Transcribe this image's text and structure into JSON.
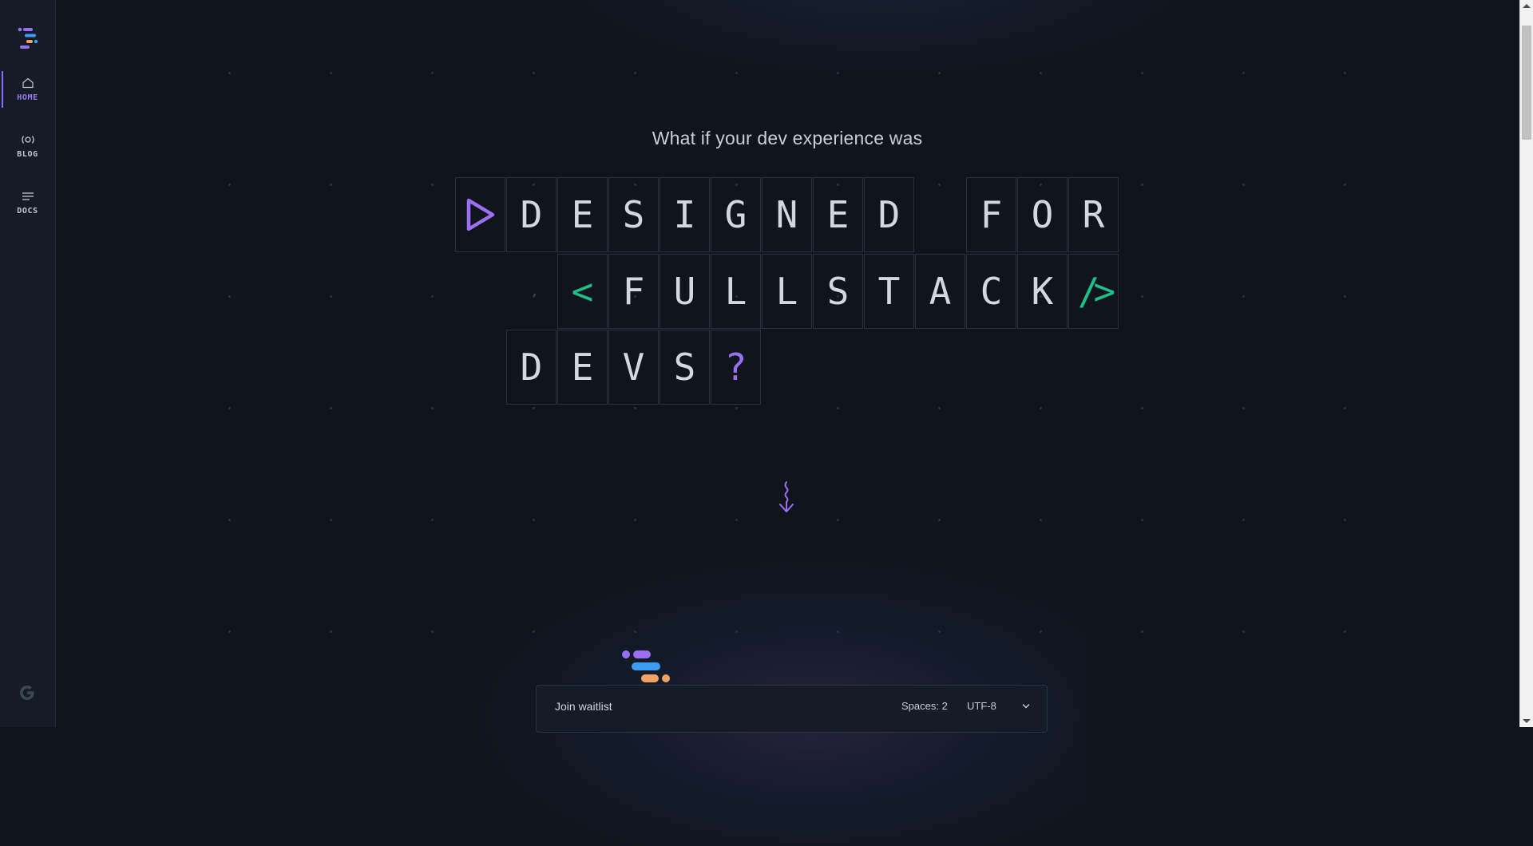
{
  "sidebar": {
    "items": [
      {
        "label": "HOME",
        "icon": "home-icon",
        "active": true
      },
      {
        "label": "BLOG",
        "icon": "broadcast-icon",
        "active": false
      },
      {
        "label": "DOCS",
        "icon": "lines-icon",
        "active": false
      }
    ],
    "footer_icon": "google-icon"
  },
  "hero": {
    "tagline": "What if your dev experience was",
    "row1": [
      "D",
      "E",
      "S",
      "I",
      "G",
      "N",
      "E",
      "D",
      "F",
      "O",
      "R"
    ],
    "row2": [
      "<",
      "F",
      "U",
      "L",
      "L",
      "S",
      "T",
      "A",
      "C",
      "K",
      "/>"
    ],
    "row3": [
      "D",
      "E",
      "V",
      "S",
      "?"
    ]
  },
  "status_bar": {
    "join_label": "Join waitlist",
    "spaces_label": "Spaces: 2",
    "encoding_label": "UTF-8"
  },
  "colors": {
    "background": "#10141d",
    "accent_purple": "#9a6ff2",
    "accent_green": "#1fbf86",
    "logo_blue": "#3b9cf0",
    "logo_orange": "#f4a261"
  }
}
